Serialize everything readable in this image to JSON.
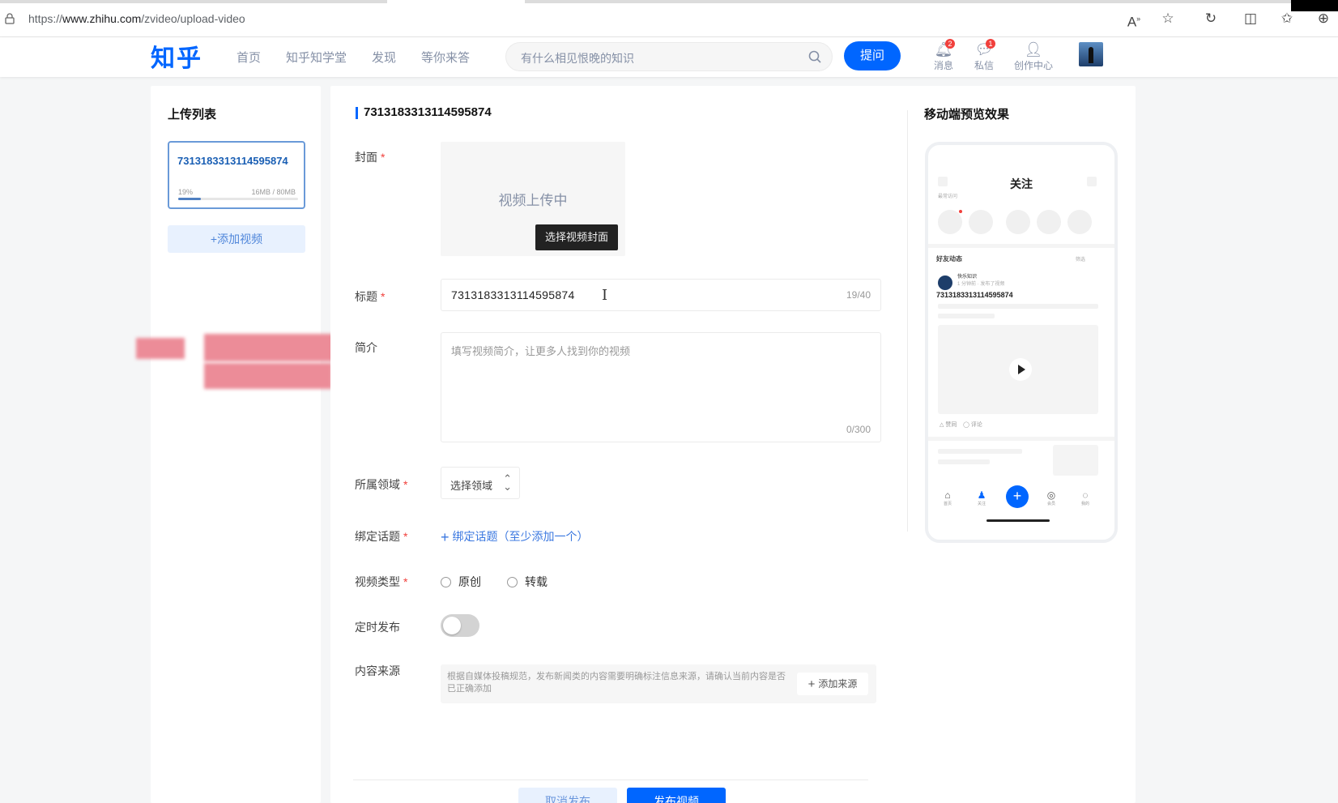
{
  "browser": {
    "url_prefix": "https://",
    "url_host": "www.zhihu.com",
    "url_path": "/zvideo/upload-video",
    "icons": [
      "read-aloud-icon",
      "favorite-star-icon",
      "refresh-icon",
      "split-screen-icon",
      "favorites-icon",
      "collections-icon"
    ]
  },
  "header": {
    "logo": "知乎",
    "nav": [
      "首页",
      "知乎知学堂",
      "发现",
      "等你来答"
    ],
    "search_placeholder": "有什么相见恨晚的知识",
    "ask_label": "提问",
    "icons": [
      {
        "label": "消息",
        "badge": "2"
      },
      {
        "label": "私信",
        "badge": "1"
      },
      {
        "label": "创作中心",
        "badge": ""
      }
    ]
  },
  "upload_list": {
    "title": "上传列表",
    "item": {
      "name": "7313183313114595874",
      "progress_text": "19%",
      "progress": 0.19,
      "size_text": "16MB / 80MB"
    },
    "add_label": "+添加视频"
  },
  "form": {
    "title": "7313183313114595874",
    "cover": {
      "label": "封面",
      "required": "*",
      "status": "视频上传中",
      "choose_label": "选择视频封面"
    },
    "title_field": {
      "label": "标题",
      "required": "*",
      "value": "7313183313114595874",
      "count": "19/40"
    },
    "intro": {
      "label": "简介",
      "placeholder": "填写视频简介，让更多人找到你的视频",
      "count": "0/300"
    },
    "domain": {
      "label": "所属领域",
      "required": "*",
      "value": "选择领域"
    },
    "topic": {
      "label": "绑定话题",
      "required": "*",
      "link": "绑定话题（至少添加一个）"
    },
    "video_type": {
      "label": "视频类型",
      "required": "*",
      "options": [
        "原创",
        "转载"
      ]
    },
    "schedule": {
      "label": "定时发布",
      "enabled": false
    },
    "source": {
      "label": "内容来源",
      "hint": "根据自媒体投稿规范，发布新闻类的内容需要明确标注信息来源，请确认当前内容是否已正确添加",
      "add_label": "添加来源"
    },
    "buttons": {
      "cancel": "取消发布",
      "publish": "发布视频"
    }
  },
  "preview": {
    "title": "移动端预览效果",
    "phone_title": "关注",
    "recent_label": "最常访问",
    "feed_label": "好友动态",
    "filter_label": "筛选",
    "author_name": "快乐知识",
    "author_meta": "1 分钟前 · 发布了视频",
    "feed_title": "7313183313114595874",
    "actions": [
      "赞同",
      "评论"
    ],
    "tabbar": [
      "首页",
      "关注",
      "会员",
      "我的"
    ]
  },
  "colors": {
    "brand": "#0066ff",
    "badge": "#f1403c"
  }
}
